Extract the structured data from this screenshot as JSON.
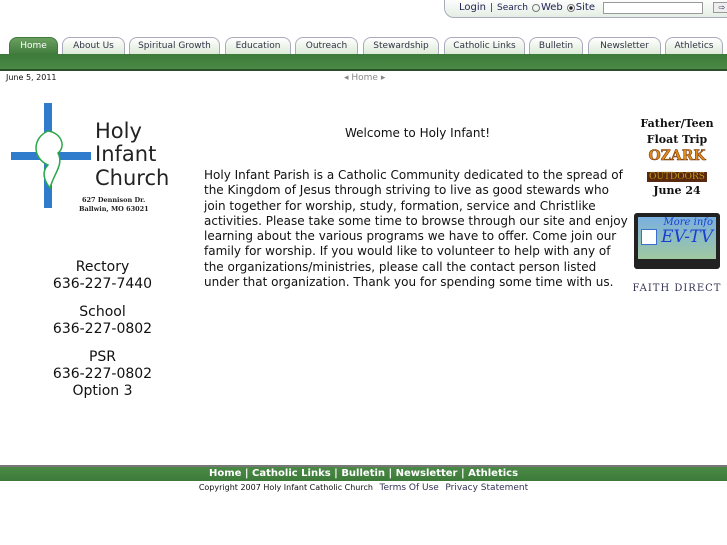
{
  "top": {
    "login": "Login",
    "sep": "|",
    "search": "Search",
    "web": "Web",
    "site": "Site",
    "go": "⇨"
  },
  "tabs": [
    "Home",
    "About Us",
    "Spiritual Growth",
    "Education",
    "Outreach",
    "Stewardship",
    "Catholic Links",
    "Bulletin",
    "Newsletter",
    "Athletics"
  ],
  "date": "June 5, 2011",
  "breadcrumb": "Home",
  "logo": {
    "l1": "Holy",
    "l2": "Infant",
    "l3": "Church",
    "addr1": "627 Dennison Dr.",
    "addr2": "Ballwin, MO 63021"
  },
  "contacts": [
    {
      "label": "Rectory",
      "phone": "636-227-7440"
    },
    {
      "label": "School",
      "phone": "636-227-0802"
    },
    {
      "label": "PSR",
      "phone": "636-227-0802",
      "extra": "Option 3"
    }
  ],
  "welcome": "Welcome to Holy Infant!",
  "body": "Holy Infant Parish is a Catholic Community dedicated to the spread of the Kingdom of Jesus through striving to live as good stewards who join together for worship, study, formation, service and Christlike activities. Please take some time to browse through our site and enjoy learning about the various programs we have to offer. Come join our family for worship. If you would like to volunteer to help with any of the organizations/ministries, please call the contact person listed under that organization. Thank you for spending some time with us.",
  "sidebar": {
    "ft1": "Father/Teen",
    "ft2": "Float Trip",
    "ozark": "OZARK",
    "outdoors": "OUTDOORS",
    "ftdate": "June 24",
    "tv1": "More info",
    "tv2": "EV-TV",
    "faith": "FAITH DIRECT"
  },
  "footer": {
    "links": [
      "Home",
      "Catholic Links",
      "Bulletin",
      "Newsletter",
      "Athletics"
    ],
    "copyright": "Copyright 2007 Holy Infant Catholic Church",
    "terms": "Terms Of Use",
    "privacy": "Privacy Statement"
  }
}
